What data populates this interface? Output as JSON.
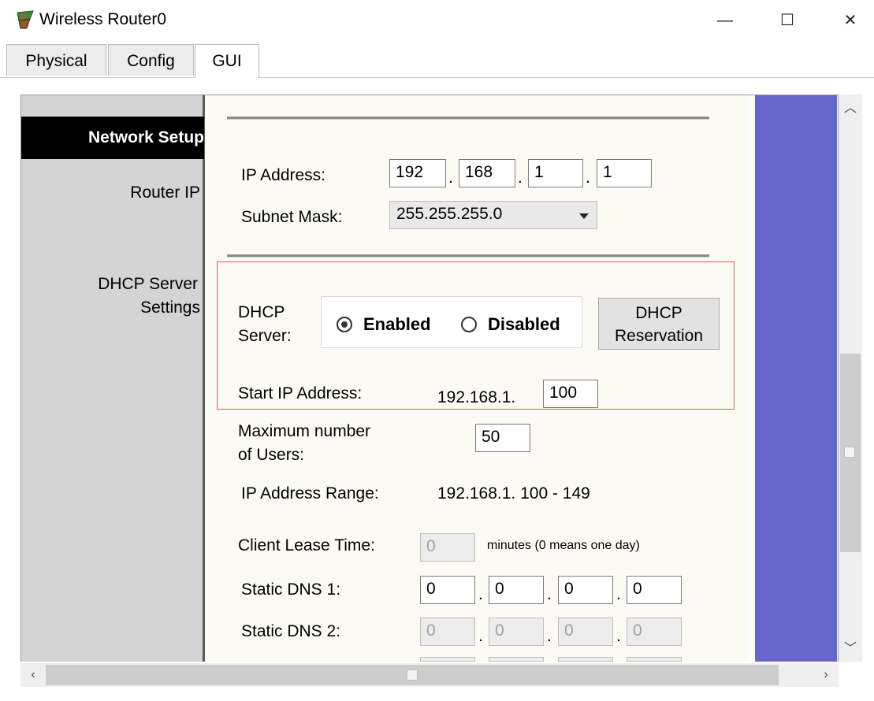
{
  "window": {
    "title": "Wireless Router0",
    "minimize_glyph": "—",
    "maximize_glyph": "☐",
    "close_glyph": "✕"
  },
  "tabs": [
    {
      "label": "Physical"
    },
    {
      "label": "Config"
    },
    {
      "label": "GUI"
    }
  ],
  "sidebar": {
    "network_setup": "Network Setup",
    "router_ip": "Router IP",
    "dhcp_line1": "DHCP Server",
    "dhcp_line2": "Settings"
  },
  "router_ip": {
    "ip_label": "IP Address:",
    "octets": [
      "192",
      "168",
      "1",
      "1"
    ],
    "subnet_label": "Subnet Mask:",
    "subnet_value": "255.255.255.0"
  },
  "dhcp": {
    "server_label_1": "DHCP",
    "server_label_2": "Server:",
    "enabled_label": "Enabled",
    "disabled_label": "Disabled",
    "selected": "Enabled",
    "reservation_line1": "DHCP",
    "reservation_line2": "Reservation",
    "start_label": "Start IP Address:",
    "start_prefix": "192.168.1.",
    "start_value": "100",
    "max_label_1": "Maximum number",
    "max_label_2": "of Users:",
    "max_value": "50",
    "range_label": "IP Address Range:",
    "range_value": "192.168.1. 100  -  149",
    "lease_label": "Client Lease Time:",
    "lease_value": "0",
    "lease_note": "minutes (0 means one day)",
    "dns1_label": "Static DNS 1:",
    "dns1": [
      "0",
      "0",
      "0",
      "0"
    ],
    "dns2_label": "Static DNS 2:",
    "dns2": [
      "0",
      "0",
      "0",
      "0"
    ]
  },
  "colors": {
    "accent_purple": "#6666cc",
    "highlight_red": "#e05a5a",
    "sidebar_bg": "#d4d4d4"
  }
}
